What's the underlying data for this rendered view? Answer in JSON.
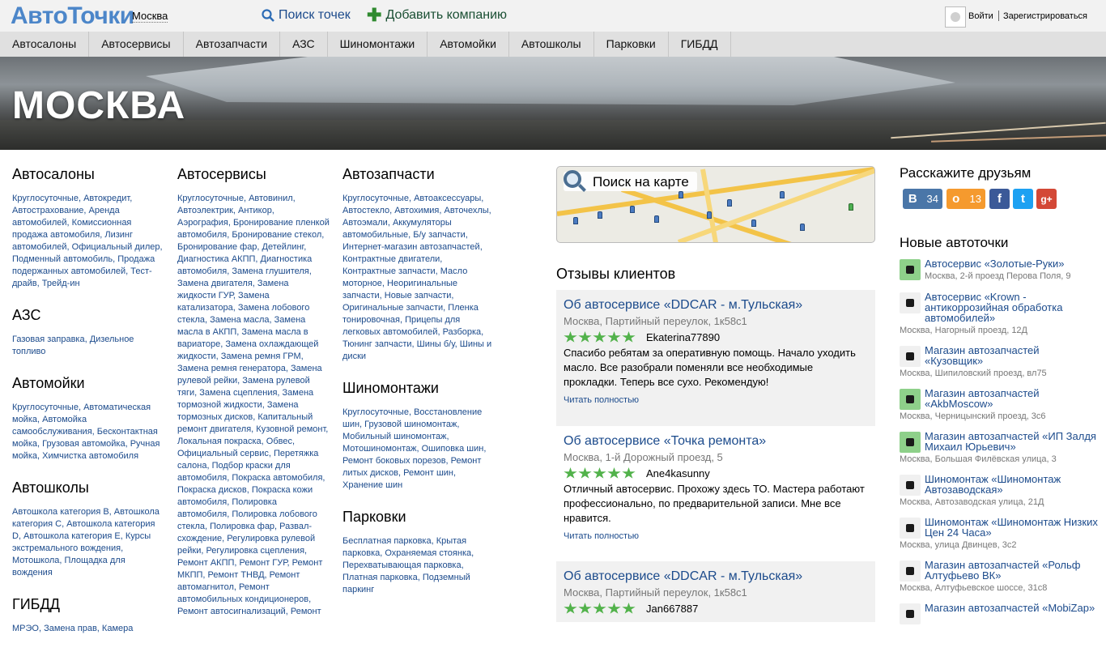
{
  "header": {
    "logo": "АвтоТочки",
    "city": "Москва",
    "search_label": "Поиск точек",
    "add_label": "Добавить компанию",
    "login": "Войти",
    "register": "Зарегистрироваться"
  },
  "nav": [
    "Автосалоны",
    "Автосервисы",
    "Автозапчасти",
    "АЗС",
    "Шиномонтажи",
    "Автомойки",
    "Автошколы",
    "Парковки",
    "ГИБДД"
  ],
  "banner_title": "МОСКВА",
  "col1": [
    {
      "title": "Автосалоны",
      "links": "Круглосуточные, Автокредит, Автострахование, Аренда автомобилей, Комиссионная продажа автомобиля, Лизинг автомобилей, Официальный дилер, Подменный автомобиль, Продажа подержанных автомобилей, Тест-драйв, Трейд-ин"
    },
    {
      "title": "АЗС",
      "links": "Газовая заправка, Дизельное топливо"
    },
    {
      "title": "Автомойки",
      "links": "Круглосуточные, Автоматическая мойка, Автомойка самообслуживания, Бесконтактная мойка, Грузовая автомойка, Ручная мойка, Химчистка автомобиля"
    },
    {
      "title": "Автошколы",
      "links": "Автошкола категория B, Автошкола категория C, Автошкола категория D, Автошкола категория E, Курсы экстремального вождения, Мотошкола, Площадка для вождения"
    },
    {
      "title": "ГИБДД",
      "links": "МРЭО, Замена прав, Камера"
    }
  ],
  "col2": [
    {
      "title": "Автосервисы",
      "links": "Круглосуточные, Автовинил, Автоэлектрик, Антикор, Аэрография, Бронирование пленкой автомобиля, Бронирование стекол, Бронирование фар, Детейлинг, Диагностика АКПП, Диагностика автомобиля, Замена глушителя, Замена двигателя, Замена жидкости ГУР, Замена катализатора, Замена лобового стекла, Замена масла, Замена масла в АКПП, Замена масла в вариаторе, Замена охлаждающей жидкости, Замена ремня ГРМ, Замена ремня генератора, Замена рулевой рейки, Замена рулевой тяги, Замена сцепления, Замена тормозной жидкости, Замена тормозных дисков, Капитальный ремонт двигателя, Кузовной ремонт, Локальная покраска, Обвес, Официальный сервис, Перетяжка салона, Подбор краски для автомобиля, Покраска автомобиля, Покраска дисков, Покраска кожи автомобиля, Полировка автомобиля, Полировка лобового стекла, Полировка фар, Развал-схождение, Регулировка рулевой рейки, Регулировка сцепления, Ремонт АКПП, Ремонт ГУР, Ремонт МКПП, Ремонт ТНВД, Ремонт автомагнитол, Ремонт автомобильных кондиционеров, Ремонт автосигнализаций, Ремонт"
    }
  ],
  "col3": [
    {
      "title": "Автозапчасти",
      "links": "Круглосуточные, Автоаксессуары, Автостекло, Автохимия, Авточехлы, Автоэмали, Аккумуляторы автомобильные, Б/у запчасти, Интернет-магазин автозапчастей, Контрактные двигатели, Контрактные запчасти, Масло моторное, Неоригинальные запчасти, Новые запчасти, Оригинальные запчасти, Пленка тонировочная, Прицепы для легковых автомобилей, Разборка, Тюнинг запчасти, Шины б/у, Шины и диски"
    },
    {
      "title": "Шиномонтажи",
      "links": "Круглосуточные, Восстановление шин, Грузовой шиномонтаж, Мобильный шиномонтаж, Мотошиномонтаж, Ошиповка шин, Ремонт боковых порезов, Ремонт литых дисков, Ремонт шин, Хранение шин"
    },
    {
      "title": "Парковки",
      "links": "Бесплатная парковка, Крытая парковка, Охраняемая стоянка, Перехватывающая парковка, Платная парковка, Подземный паркинг"
    }
  ],
  "map_label": "Поиск на карте",
  "reviews_title": "Отзывы клиентов",
  "reviews": [
    {
      "title": "Об автосервисе «DDCAR - м.Тульская»",
      "address": "Москва, Партийный переулок, 1к58с1",
      "rating": 5,
      "user": "Ekaterina77890",
      "text": "Спасибо ребятам за оперативную помощь. Начало уходить масло. Все разобрали поменяли все необходимые прокладки. Теперь все сухо. Рекомендую!",
      "more": "Читать полностью"
    },
    {
      "title": "Об автосервисе «Точка ремонта»",
      "address": "Москва, 1-й Дорожный проезд, 5",
      "rating": 5,
      "user": "Ane4kasunny",
      "text": "Отличный автосервис. Прохожу здесь ТО. Мастера работают профессионально, по предварительной записи. Мне все нравится.",
      "more": "Читать полностью"
    },
    {
      "title": "Об автосервисе «DDCAR - м.Тульская»",
      "address": "Москва, Партийный переулок, 1к58с1",
      "rating": 5,
      "user": "Jan667887",
      "text": "",
      "more": ""
    }
  ],
  "share": {
    "title": "Расскажите друзьям",
    "vk_count": "34",
    "ok_count": "13",
    "colors": {
      "vk": "#4a76a8",
      "ok": "#f59a2e",
      "fb": "#3b5998",
      "tw": "#1da1f2",
      "gp": "#d34836"
    }
  },
  "new_points": {
    "title": "Новые автоточки",
    "items": [
      {
        "name": "Автосервис «Золотые-Руки»",
        "address": "Москва, 2-й проезд Перова Поля, 9",
        "icon": "wrench-icon",
        "green": true
      },
      {
        "name": "Автосервис «Krown - антикоррозийная обработка автомобилей»",
        "address": "Москва, Нагорный проезд, 12Д",
        "icon": "wrench-icon",
        "green": false
      },
      {
        "name": "Магазин автозапчастей «Кузовщик»",
        "address": "Москва, Шипиловский проезд, вл75",
        "icon": "car-part-icon",
        "green": false
      },
      {
        "name": "Магазин автозапчастей «AkbMoscow»",
        "address": "Москва, Черницынский проезд, 3с6",
        "icon": "car-part-icon",
        "green": true
      },
      {
        "name": "Магазин автозапчастей «ИП Залдя Михаил Юрьевич»",
        "address": "Москва, Большая Филёвская улица, 3",
        "icon": "car-part-icon",
        "green": true
      },
      {
        "name": "Шиномонтаж «Шиномонтаж Автозаводская»",
        "address": "Москва, Автозаводская улица, 21Д",
        "icon": "tire-icon",
        "green": false
      },
      {
        "name": "Шиномонтаж «Шиномонтаж Низких Цен 24 Часа»",
        "address": "Москва, улица Двинцев, 3с2",
        "icon": "tire-icon",
        "green": false
      },
      {
        "name": "Магазин автозапчастей «Рольф Алтуфьево ВК»",
        "address": "Москва, Алтуфьевское шоссе, 31с8",
        "icon": "car-part-icon",
        "green": false
      },
      {
        "name": "Магазин автозапчастей «MobiZap»",
        "address": "",
        "icon": "car-part-icon",
        "green": false
      }
    ]
  }
}
